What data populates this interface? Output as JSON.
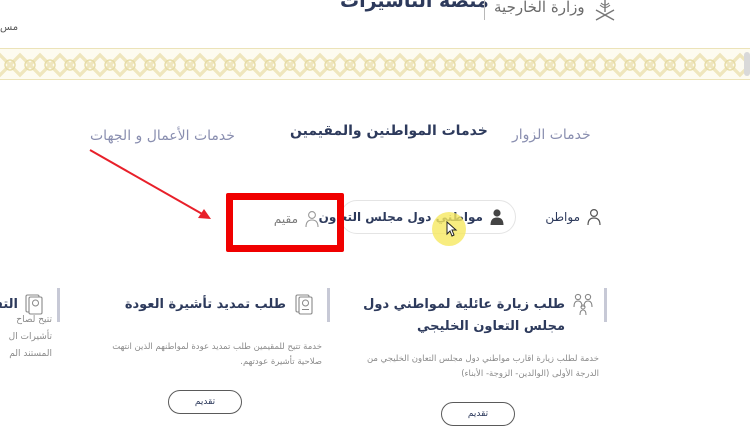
{
  "header": {
    "site_title": "منصة التأشيرات",
    "ministry_name": "وزارة الخارجية",
    "cut_text": "مس"
  },
  "main_tabs": [
    {
      "label": "خدمات الزوار",
      "state": "inactive"
    },
    {
      "label": "خدمات المواطنين والمقيمين",
      "state": "active"
    },
    {
      "label": "خدمات الأعمال و الجهات",
      "state": "inactive"
    }
  ],
  "sub_tabs": [
    {
      "label": "مواطن",
      "icon": "person-icon"
    },
    {
      "label": "مواطني دول مجلس التعاون",
      "icon": "person-filled-icon",
      "state": "selected"
    },
    {
      "label": "مقيم",
      "icon": "person-outline-icon"
    }
  ],
  "cards": [
    {
      "title": "طلب زيارة عائلية لمواطني دول مجلس التعاون الخليجي",
      "description": "خدمة لطلب زيارة اقارب مواطني دول مجلس التعاون الخليجي من الدرجة الأولى (الوالدين- الزوجة- الأبناء)",
      "button_label": "تقديم",
      "icon": "family-icon"
    },
    {
      "title": "طلب تمديد تأشيرة العودة",
      "description": "خدمة تتيح للمقيمين طلب تمديد عودة لمواطنهم الذين انتهت صلاحية تأشيرة عودتهم.",
      "button_label": "تقديم",
      "icon": "passport-icon"
    },
    {
      "title": "التف",
      "description": "تتيح لصاح\nتأشيرات ال\nالمستند الم",
      "icon": "passport-icon"
    }
  ],
  "colors": {
    "primary_text": "#2d3a5c",
    "inactive_tab": "#8a8fb0",
    "highlight": "#f00000",
    "pattern_gold": "#e6dba4"
  }
}
